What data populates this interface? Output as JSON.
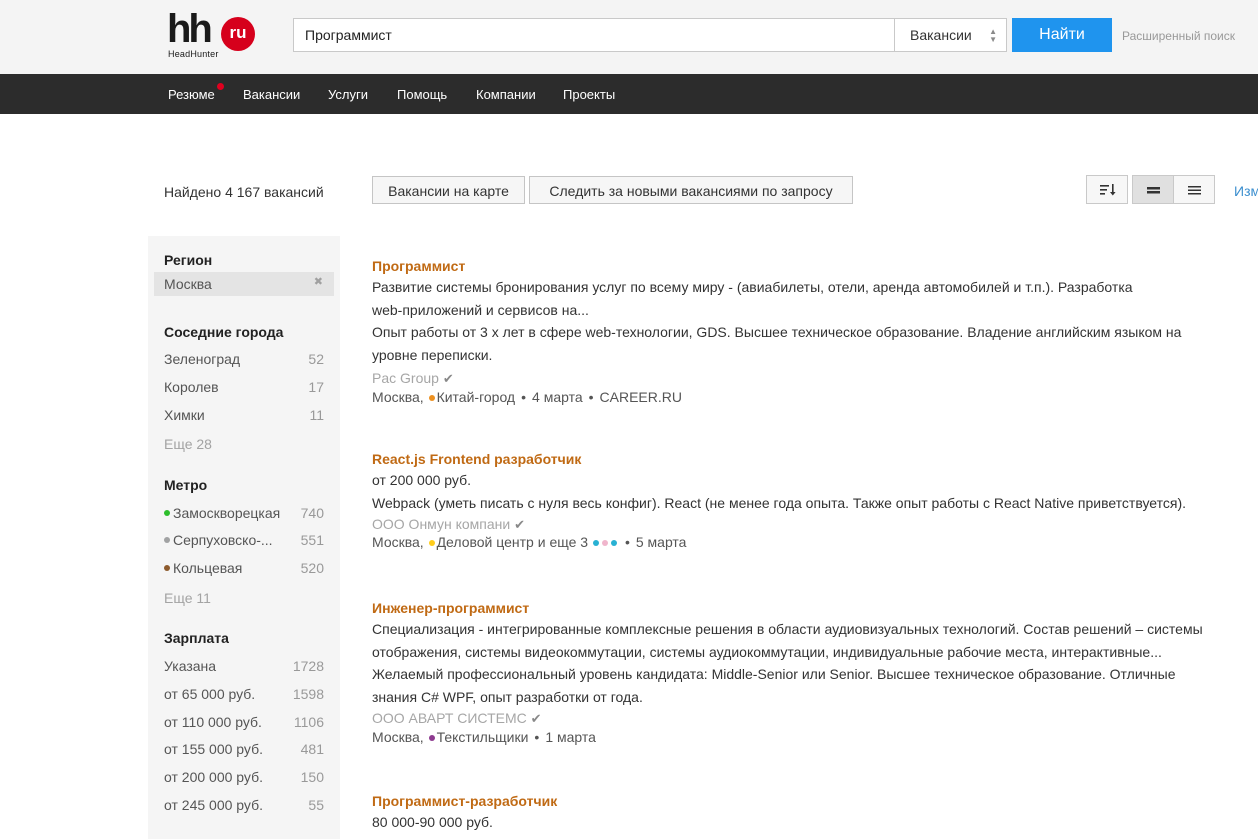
{
  "header": {
    "logo_main": "hh",
    "logo_badge": "ru",
    "logo_sub": "HeadHunter",
    "search_value": "Программист",
    "search_type": "Вакансии",
    "search_button": "Найти",
    "advanced_search": "Расширенный поиск"
  },
  "nav": {
    "items": [
      "Резюме",
      "Вакансии",
      "Услуги",
      "Помощь",
      "Компании",
      "Проекты"
    ],
    "notification_color": "#e0001f"
  },
  "toolbar": {
    "found": "Найдено 4 167 вакансий",
    "map_button": "Вакансии на карте",
    "subscribe_button": "Следить за новыми вакансиями по запросу",
    "cut_link": "Изм"
  },
  "sidebar": {
    "region": {
      "heading": "Регион",
      "selected": "Москва"
    },
    "nearby": {
      "heading": "Соседние города",
      "items": [
        {
          "label": "Зеленоград",
          "count": "52"
        },
        {
          "label": "Королев",
          "count": "17"
        },
        {
          "label": "Химки",
          "count": "11"
        }
      ],
      "more": "Еще 28"
    },
    "metro": {
      "heading": "Метро",
      "items": [
        {
          "label": "Замоскворецкая",
          "count": "740",
          "color": "#2dbe2c"
        },
        {
          "label": "Серпуховско-...",
          "count": "551",
          "color": "#a1a2a3"
        },
        {
          "label": "Кольцевая",
          "count": "520",
          "color": "#8d5b2d"
        }
      ],
      "more": "Еще 11"
    },
    "salary": {
      "heading": "Зарплата",
      "items": [
        {
          "label": "Указана",
          "count": "1728"
        },
        {
          "label": "от 65 000 руб.",
          "count": "1598"
        },
        {
          "label": "от 110 000 руб.",
          "count": "1106"
        },
        {
          "label": "от 155 000 руб.",
          "count": "481"
        },
        {
          "label": "от 200 000 руб.",
          "count": "150"
        },
        {
          "label": "от 245 000 руб.",
          "count": "55"
        }
      ]
    }
  },
  "vacancies": [
    {
      "title": "Программист",
      "lines": [
        "Развитие системы бронирования услуг по всему миру - (авиабилеты, отели, аренда автомобилей и т.п.). Разработка",
        "web-приложений и сервисов на...",
        "Опыт работы от 3 х лет в сфере web-технологии, GDS. Высшее техническое образование. Владение английским языком на",
        "уровне переписки."
      ],
      "company": "Pac Group",
      "city": "Москва,",
      "metro": "Китай-город",
      "metro_color": "#ed9121",
      "date": "4 марта",
      "source": "CAREER.RU"
    },
    {
      "title": "React.js Frontend разработчик",
      "lines": [
        "от 200 000 руб.",
        "Webpack (уметь писать с нуля весь конфиг). React (не менее года опыта. Также опыт работы с React Native приветствуется)."
      ],
      "company": "ООО Онмун компани",
      "city": "Москва,",
      "metro": "Деловой центр и еще 3",
      "metro_color": "#ffcd1c",
      "extra_dot_colors": [
        "#29b1d3",
        "#f0b5cc",
        "#29b1d3"
      ],
      "date": "5 марта"
    },
    {
      "title": "Инженер-программист",
      "lines": [
        "Специализация - интегрированные комплексные решения в области аудиовизуальных технологий. Состав решений – системы",
        "отображения, системы видеокоммутации, системы аудиокоммутации, индивидуальные рабочие места, интерактивные...",
        "Желаемый профессиональный уровень кандидата: Middle-Senior или Senior. Высшее техническое образование. Отличные",
        "знания C# WPF, опыт разработки от года."
      ],
      "company": "ООО АВАРТ СИСТЕМС",
      "city": "Москва,",
      "metro": "Текстильщики",
      "metro_color": "#8d3a8f",
      "date": "1 марта"
    },
    {
      "title": "Программист-разработчик",
      "lines": [
        "80 000-90 000 руб."
      ]
    }
  ]
}
